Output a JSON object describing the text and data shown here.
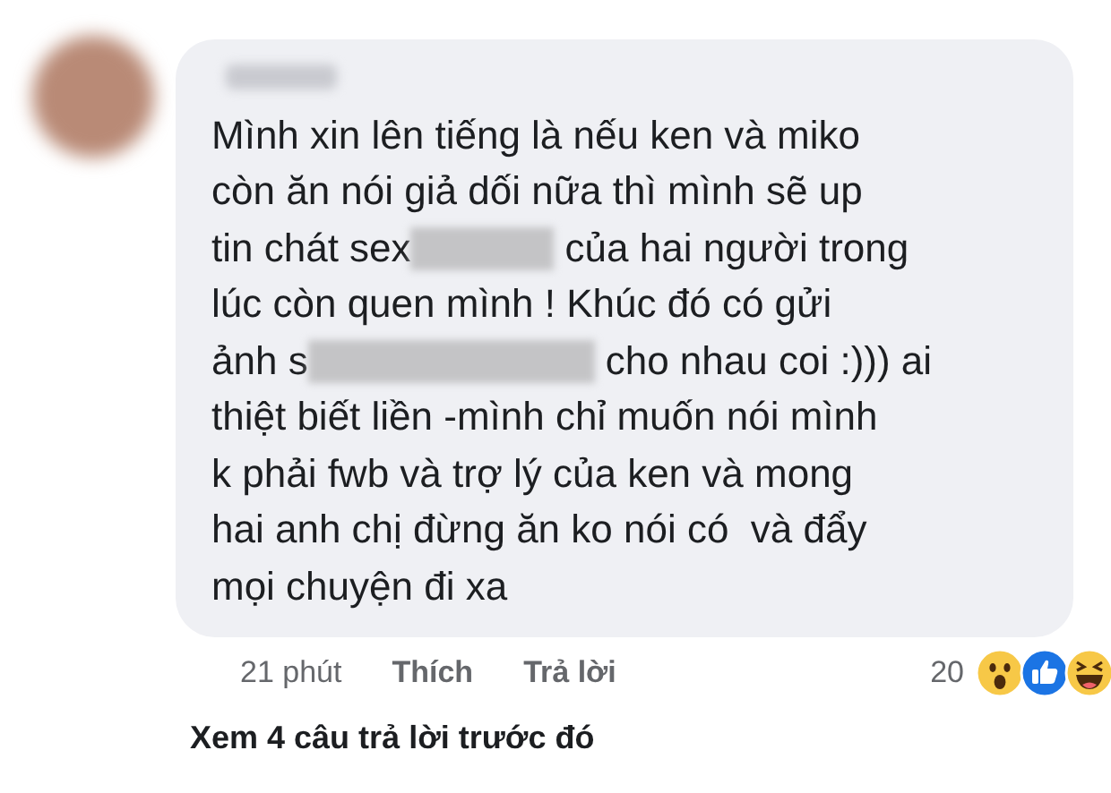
{
  "comment": {
    "lines": [
      {
        "segments": [
          {
            "kind": "text",
            "text": "Mình xin lên tiếng là nếu ken và miko"
          }
        ]
      },
      {
        "segments": [
          {
            "kind": "text",
            "text": "còn ăn nói giả dối nữa thì mình sẽ up"
          }
        ]
      },
      {
        "segments": [
          {
            "kind": "text",
            "text": "tin chát sex"
          },
          {
            "kind": "redacted"
          },
          {
            "kind": "text",
            "text": "của hai người trong"
          }
        ]
      },
      {
        "segments": [
          {
            "kind": "text",
            "text": "lúc còn quen mình ! Khúc đó có gửi"
          }
        ]
      },
      {
        "segments": [
          {
            "kind": "text",
            "text": "ảnh s"
          },
          {
            "kind": "redacted"
          },
          {
            "kind": "text",
            "text": "cho nhau coi :))) ai"
          }
        ]
      },
      {
        "segments": [
          {
            "kind": "text",
            "text": "thiệt biết liền -mình chỉ muốn nói mình"
          }
        ]
      },
      {
        "segments": [
          {
            "kind": "text",
            "text": "k phải fwb và trợ lý của ken và mong"
          }
        ]
      },
      {
        "segments": [
          {
            "kind": "text",
            "text": "hai anh chị đừng ăn ko nói có  và đẩy"
          }
        ]
      },
      {
        "segments": [
          {
            "kind": "text",
            "text": "mọi chuyện đi xa"
          }
        ]
      }
    ]
  },
  "actions": {
    "time": "21 phút",
    "like": "Thích",
    "reply": "Trả lời",
    "reaction_count": "20"
  },
  "view_previous": "Xem 4 câu trả lời trước đó"
}
